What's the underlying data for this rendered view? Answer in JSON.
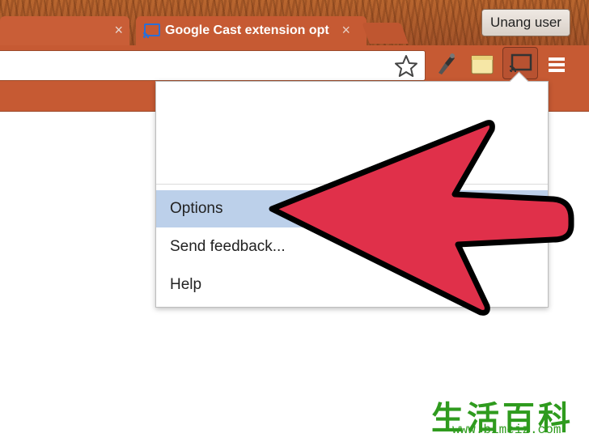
{
  "browser": {
    "tabs": [
      {
        "title": "",
        "close_glyph": "×",
        "active": false
      },
      {
        "title": "Google Cast extension opt",
        "close_glyph": "×",
        "active": true
      }
    ],
    "user_button_label": "Unang user"
  },
  "toolbar": {
    "icons": [
      "star-icon",
      "brush-extension-icon",
      "note-extension-icon",
      "cast-icon",
      "menu-icon"
    ]
  },
  "cast_menu": {
    "items": [
      "Options",
      "Send feedback...",
      "Help"
    ],
    "highlighted": "Options"
  },
  "overlay": {
    "arrow_color": "#e0304a",
    "arrow_outline": "#000000"
  },
  "watermark": {
    "chinese": "生活百科",
    "url": "www.bimeiz.com"
  },
  "colors": {
    "frame": "#c65a33",
    "highlight": "#bcd0ea"
  }
}
